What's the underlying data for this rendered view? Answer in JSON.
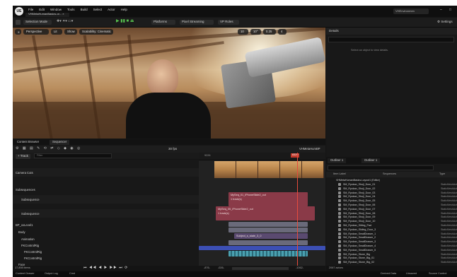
{
  "app": {
    "logo": "UE",
    "menu": [
      "File",
      "Edit",
      "Window",
      "Tools",
      "Build",
      "Select",
      "Actor",
      "Help"
    ],
    "project_tab": "VHMetaHumanBasics-or... ×",
    "project_name": "VHEnvironmen"
  },
  "toolbar": {
    "mode": "Selection Mode",
    "platforms": "Platforms",
    "pixel_streaming": "Pixel Streaming",
    "vp_roles": "VP Roles",
    "settings": "Settings"
  },
  "viewport": {
    "perspective": "Perspective",
    "lit": "Lit",
    "show": "Show",
    "scalability": "Scalability: Cinematic",
    "grid_values": [
      "10",
      "10°",
      "0.25",
      "4"
    ]
  },
  "details": {
    "title": "Details",
    "hint": "Select an object to view details."
  },
  "sequencer": {
    "tabs": [
      "Content Browser",
      "Sequencer"
    ],
    "fps": "30 fps",
    "breadcrumb": "VHMetaHumBP",
    "add_track": "+ Track",
    "filter_placeholder": "Filter",
    "tracks": [
      "Camera Cuts",
      "Subsequences",
      "Subsequence",
      "Subsequence",
      "BP_xxLevel1",
      "Body",
      "Animation",
      "FKControlRig",
      "FKControlRig",
      "FKControlRig",
      "Face"
    ],
    "segments": [
      {
        "label": "MySeq_01_iPhoneSlide2_cut",
        "sub": "1 track(s)"
      },
      {
        "label": "MySeq_05_iPhoneSlide2_cut",
        "sub": "1 track(s)"
      },
      {
        "label": "Subject_s_state_3_0"
      }
    ],
    "item_count": "17,898 items",
    "ruler": [
      "9226",
      "8329"
    ],
    "bottom_left": "-876-",
    "bottom_mid": "-026-",
    "bottom_right": "-1062-"
  },
  "outliner": {
    "tabs": [
      "Outliner 1",
      "Outliner 1"
    ],
    "col_item": "Item Label",
    "col_seq": "Sequences",
    "col_type": "Type",
    "root": "VHMetaHumanBasics-Layout1 (Editor)",
    "rows": [
      "SM_Ryokan_Shoji_Door_01",
      "SM_Ryokan_Shoji_Door_02",
      "SM_Ryokan_Shoji_Door_03",
      "SM_Ryokan_Shoji_Door_04",
      "SM_Ryokan_Shoji_Door_05",
      "SM_Ryokan_Shoji_Door_06",
      "SM_Ryokan_Shoji_Door_07",
      "SM_Ryokan_Shoji_Door_08",
      "SM_Ryokan_Shoji_Door_09",
      "SM_Ryokan_Shoji_Door_10",
      "SM_Ryokan_Sitting_Pad",
      "SM_Ryokan_Sliding_Door_3",
      "SM_Ryokan_SmallDrawer_1",
      "SM_Ryokan_SmallDrawer_2",
      "SM_Ryokan_SmallDrawer_3",
      "SM_Ryokan_SmallDrawer_4",
      "SM_Ryokan_SmallDrawer_5",
      "SM_Ryokan_Stone_Big",
      "SM_Ryokan_Stone_Big_01",
      "SM_Ryokan_Stone_Big_02"
    ],
    "row_type": "StaticMeshActor",
    "actor_count": "2067 actors"
  },
  "status": {
    "items": [
      "Content Drawer",
      "Output Log",
      "Cmd"
    ],
    "right": [
      "Derived Data",
      "Unsaved",
      "Source Control"
    ]
  }
}
